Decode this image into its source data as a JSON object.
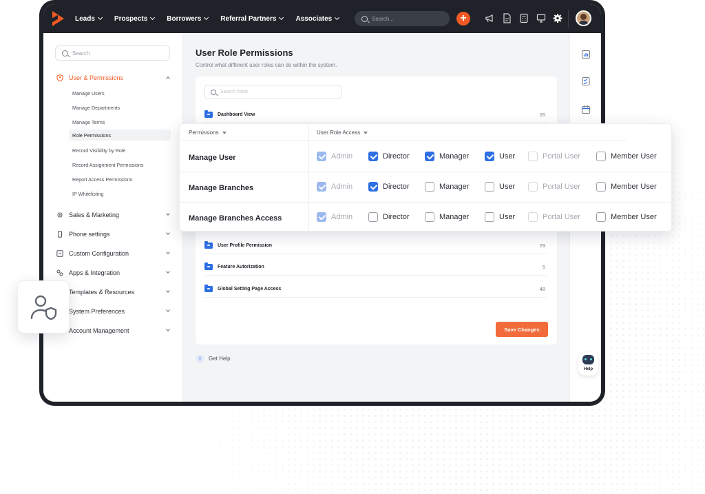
{
  "topbar": {
    "nav": [
      {
        "label": "Leads"
      },
      {
        "label": "Prospects"
      },
      {
        "label": "Borrowers"
      },
      {
        "label": "Referral Partners"
      },
      {
        "label": "Associates"
      }
    ],
    "search_placeholder": "Search...",
    "add_label": "+"
  },
  "sidebar": {
    "search_placeholder": "Search",
    "active_section": "User & Permissions",
    "sub_items": [
      "Manage Users",
      "Manage Departments",
      "Manage Terms",
      "Role Permissions",
      "Record Visibility by Role",
      "Record Assignment Permissions",
      "Report Access Permissions",
      "IP Whitelisting"
    ],
    "sections": [
      "Sales & Marketing",
      "Phone settings",
      "Custom Configuration",
      "Apps & Integration",
      "Templates & Resources",
      "System Preferences",
      "Account Management"
    ]
  },
  "main": {
    "title": "User Role Permissions",
    "subtitle": "Control what different user roles can do within the system.",
    "card_search_placeholder": "Search fields",
    "folders": [
      {
        "name": "Dashboard View",
        "count": "26"
      },
      {
        "name": "User Profile Permission",
        "count": "29"
      },
      {
        "name": "Feature Autorization",
        "count": "5"
      },
      {
        "name": "Global Setting Page Access",
        "count": "48"
      }
    ],
    "save_label": "Save Changes",
    "help_label": "Get Help"
  },
  "rail": {
    "help_label": "Help"
  },
  "panel": {
    "col_permissions": "Permissions",
    "col_access": "User Role Access",
    "roles": [
      "Admin",
      "Director",
      "Manager",
      "User",
      "Portal User",
      "Member User"
    ],
    "rows": [
      {
        "name": "Manage User",
        "checked": [
          true,
          true,
          true,
          true,
          false,
          false
        ]
      },
      {
        "name": "Manage Branches",
        "checked": [
          true,
          true,
          false,
          false,
          false,
          false
        ]
      },
      {
        "name": "Manage Branches Access",
        "checked": [
          true,
          false,
          false,
          false,
          false,
          false
        ]
      }
    ]
  },
  "colors": {
    "accent": "#f15a24",
    "check_blue": "#2f6fe4"
  }
}
